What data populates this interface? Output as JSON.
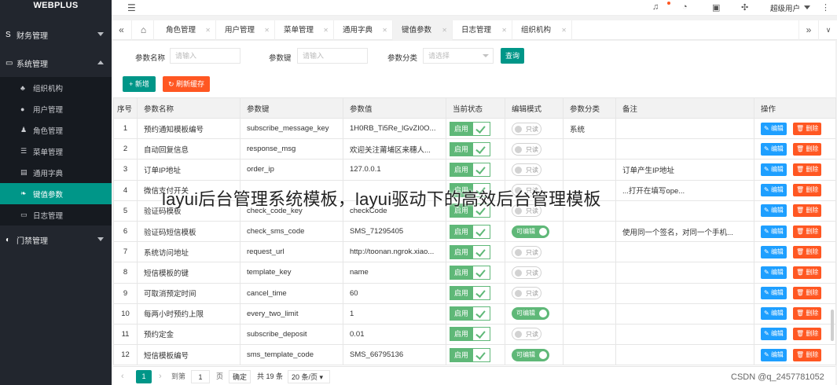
{
  "app": {
    "logo": "WEBPLUS"
  },
  "sidebar": {
    "groups": [
      {
        "label": "财务管理",
        "icon": "dollar-icon"
      },
      {
        "label": "系统管理",
        "icon": "monitor-icon"
      },
      {
        "label": "门禁管理",
        "icon": "half-circle-icon"
      }
    ],
    "items": [
      {
        "label": "组织机构",
        "icon": "org-tree-icon"
      },
      {
        "label": "用户管理",
        "icon": "user-icon"
      },
      {
        "label": "角色管理",
        "icon": "role-icon"
      },
      {
        "label": "菜单管理",
        "icon": "menu-list-icon"
      },
      {
        "label": "通用字典",
        "icon": "book-icon"
      },
      {
        "label": "键值参数",
        "icon": "leaf-icon"
      },
      {
        "label": "日志管理",
        "icon": "log-monitor-icon"
      }
    ]
  },
  "header": {
    "user_name": "超级用户"
  },
  "tabs": {
    "items": [
      "角色管理",
      "用户管理",
      "菜单管理",
      "通用字典",
      "键值参数",
      "日志管理",
      "组织机构"
    ],
    "active": "键值参数"
  },
  "search": {
    "name_label": "参数名称",
    "name_placeholder": "请输入",
    "key_label": "参数键",
    "key_placeholder": "请输入",
    "cat_label": "参数分类",
    "cat_placeholder": "请选择",
    "query_label": "查询"
  },
  "toolbar": {
    "add_label": "+ 新增",
    "refresh_label": "刷新缓存"
  },
  "table": {
    "columns": [
      "序号",
      "参数名称",
      "参数键",
      "参数值",
      "当前状态",
      "编辑模式",
      "参数分类",
      "备注",
      "操作"
    ],
    "state_label": "启用",
    "readonly_label": "只读",
    "editable_label": "可编辑",
    "edit_label": "编辑",
    "delete_label": "删除",
    "rows": [
      {
        "no": "1",
        "name": "预约通知模板编号",
        "key": "subscribe_message_key",
        "value": "1H0RB_Ti5Re_lGvZI0O...",
        "editable": false,
        "category": "系统",
        "remark": ""
      },
      {
        "no": "2",
        "name": "自动回复信息",
        "key": "response_msg",
        "value": "欢迎关注莆埔区来穗人...",
        "editable": false,
        "category": "",
        "remark": ""
      },
      {
        "no": "3",
        "name": "订单IP地址",
        "key": "order_ip",
        "value": "127.0.0.1",
        "editable": false,
        "category": "",
        "remark": "订单产生IP地址"
      },
      {
        "no": "4",
        "name": "微信支付开关",
        "key": "",
        "value": "",
        "editable": false,
        "category": "",
        "remark": "...打开在填写ope..."
      },
      {
        "no": "5",
        "name": "验证码模板",
        "key": "check_code_key",
        "value": "checkCode",
        "editable": false,
        "category": "",
        "remark": ""
      },
      {
        "no": "6",
        "name": "验证码短信模板",
        "key": "check_sms_code",
        "value": "SMS_71295405",
        "editable": true,
        "category": "",
        "remark": "使用同一个签名，对同一个手机..."
      },
      {
        "no": "7",
        "name": "系统访问地址",
        "key": "request_url",
        "value": "http://toonan.ngrok.xiao...",
        "editable": false,
        "category": "",
        "remark": ""
      },
      {
        "no": "8",
        "name": "短信模板的键",
        "key": "template_key",
        "value": "name",
        "editable": false,
        "category": "",
        "remark": ""
      },
      {
        "no": "9",
        "name": "可取消预定时间",
        "key": "cancel_time",
        "value": "60",
        "editable": false,
        "category": "",
        "remark": ""
      },
      {
        "no": "10",
        "name": "每两小时预约上限",
        "key": "every_two_limit",
        "value": "1",
        "editable": true,
        "category": "",
        "remark": ""
      },
      {
        "no": "11",
        "name": "预约定金",
        "key": "subscribe_deposit",
        "value": "0.01",
        "editable": false,
        "category": "",
        "remark": ""
      },
      {
        "no": "12",
        "name": "短信模板编号",
        "key": "sms_template_code",
        "value": "SMS_66795136",
        "editable": true,
        "category": "",
        "remark": ""
      }
    ]
  },
  "pager": {
    "current": "1",
    "goto_label": "到第",
    "goto_value": "1",
    "page_unit": "页",
    "confirm": "确定",
    "total": "共 19 条",
    "page_size": "20 条/页"
  },
  "overlay": {
    "title": "layui后台管理系统模板，layui驱动下的高效后台管理模板",
    "credit": "CSDN @q_2457781052"
  }
}
